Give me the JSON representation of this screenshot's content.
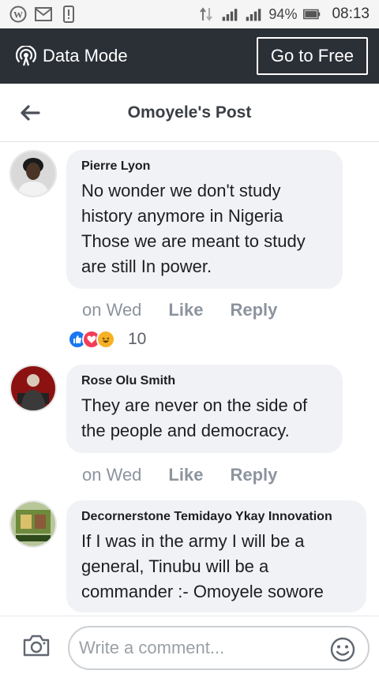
{
  "status_bar": {
    "battery": "94%",
    "time": "08:13"
  },
  "data_mode": {
    "label": "Data Mode",
    "go_free": "Go to Free"
  },
  "header": {
    "title": "Omoyele's Post"
  },
  "comments": [
    {
      "author": "Pierre Lyon",
      "lines": [
        "No wonder we don't study",
        "history anymore in Nigeria",
        "Those we are meant to study",
        "are still In power."
      ],
      "time": "on Wed",
      "like": "Like",
      "reply": "Reply",
      "reaction_count": "10"
    },
    {
      "author": "Rose Olu Smith",
      "lines": [
        "They are never on the side of",
        "the people and democracy."
      ],
      "time": "on Wed",
      "like": "Like",
      "reply": "Reply"
    },
    {
      "author": "Decornerstone Temidayo Ykay Innovation",
      "lines": [
        "If I was in the army I will be a",
        "general, Tinubu will be a",
        "commander :- Omoyele sowore"
      ]
    }
  ],
  "compose": {
    "placeholder": "Write a comment..."
  },
  "colors": {
    "banner": "#2b2f36",
    "bubble": "#f0f2f5",
    "like_blue": "#1877f2",
    "love_red": "#f33e58",
    "haha_yellow": "#f7b125"
  }
}
